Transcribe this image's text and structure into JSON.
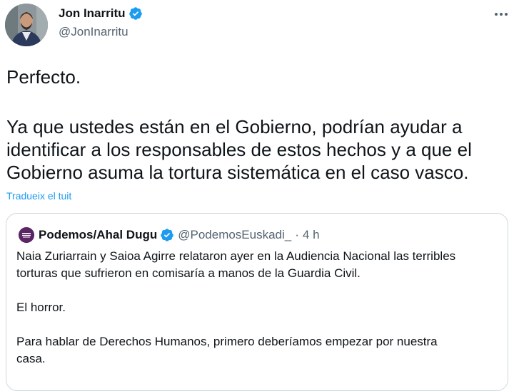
{
  "author": {
    "display_name": "Jon Inarritu",
    "handle": "@JonInarritu"
  },
  "tweet": {
    "line1": "Perfecto.",
    "paragraph2_line1": "Ya que ustedes están en el Gobierno, podrían ayudar a",
    "paragraph2_line2": "identificar a los responsables de estos hechos y a que el",
    "paragraph2_line3": "Gobierno asuma la tortura sistemática en el caso vasco.",
    "translate_link": "Tradueix el tuit"
  },
  "quoted_tweet": {
    "display_name": "Podemos/Ahal Dugu",
    "handle": "@PodemosEuskadi_",
    "separator": "·",
    "time": "4 h",
    "para1_line1": "Naia Zuriarrain y Saioa Agirre relataron ayer en la Audiencia Nacional las terribles",
    "para1_line2": "torturas que sufrieron en comisaría a manos de la Guardia Civil.",
    "para2": "El horror.",
    "para3_line1": "Para hablar de Derechos Humanos, primero deberíamos empezar por nuestra",
    "para3_line2": "casa."
  },
  "colors": {
    "text": "#0f1419",
    "secondary": "#536471",
    "link": "#1d9bf0",
    "verified": "#1d9bf0",
    "border": "#cfd9de",
    "podemos_purple": "#5b2666"
  },
  "icons": {
    "more": "more-horizontal-icon",
    "verified": "verified-badge-icon"
  }
}
